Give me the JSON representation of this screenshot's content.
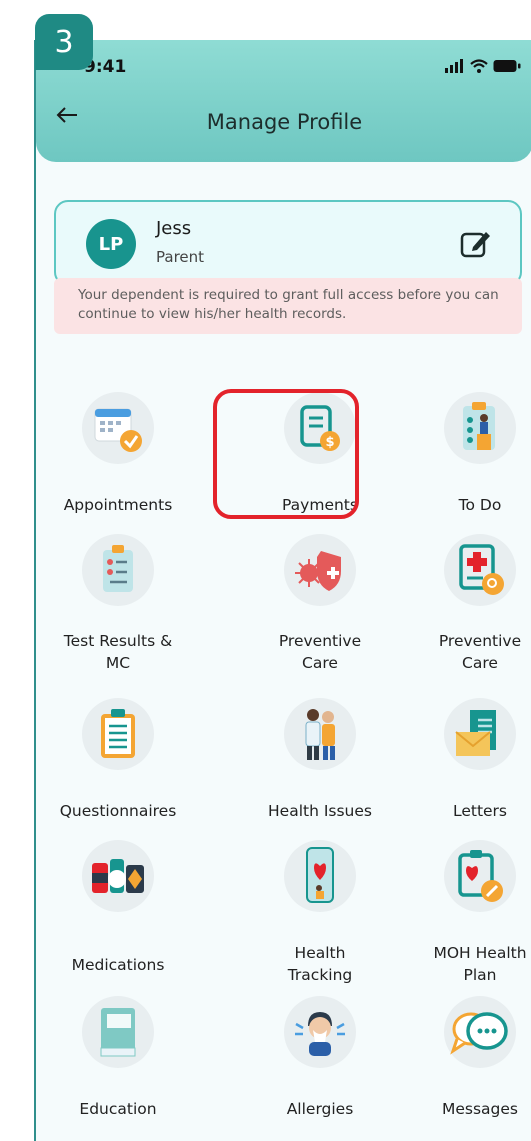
{
  "step_badge": "3",
  "status_bar": {
    "time": "9:41"
  },
  "header": {
    "title": "Manage Profile"
  },
  "profile": {
    "initials": "LP",
    "name": "Jess",
    "role": "Parent"
  },
  "notice": "Your dependent is required to grant full access before you can continue to view his/her health records.",
  "tiles": [
    {
      "label": "Appointments",
      "icon": "calendar-check-icon"
    },
    {
      "label": "Payments",
      "icon": "bill-dollar-icon"
    },
    {
      "label": "To Do",
      "icon": "clipboard-person-icon"
    },
    {
      "label_line1": "Test Results &",
      "label_line2": "MC",
      "icon": "test-results-clipboard-icon"
    },
    {
      "label_line1": "Preventive",
      "label_line2": "Care",
      "icon": "virus-shield-icon"
    },
    {
      "label_line1": "Preventive",
      "label_line2": "Care",
      "icon": "medical-document-search-icon"
    },
    {
      "label": "Questionnaires",
      "icon": "questionnaire-clipboard-icon"
    },
    {
      "label": "Health Issues",
      "icon": "doctor-patient-icon"
    },
    {
      "label": "Letters",
      "icon": "envelope-letter-icon"
    },
    {
      "label": "Medications",
      "icon": "pills-icon"
    },
    {
      "label_line1": "Health",
      "label_line2": "Tracking",
      "icon": "phone-tracking-icon"
    },
    {
      "label_line1": "MOH Health",
      "label_line2": "Plan",
      "icon": "health-plan-icon"
    },
    {
      "label": "Education",
      "icon": "book-icon"
    },
    {
      "label": "Allergies",
      "icon": "sneezing-person-icon"
    },
    {
      "label": "Messages",
      "icon": "chat-bubbles-icon"
    }
  ],
  "colors": {
    "header": "#7fd3cc",
    "accent": "#18948e",
    "highlight": "#e3232b",
    "notice_bg": "#fbe3e4"
  }
}
